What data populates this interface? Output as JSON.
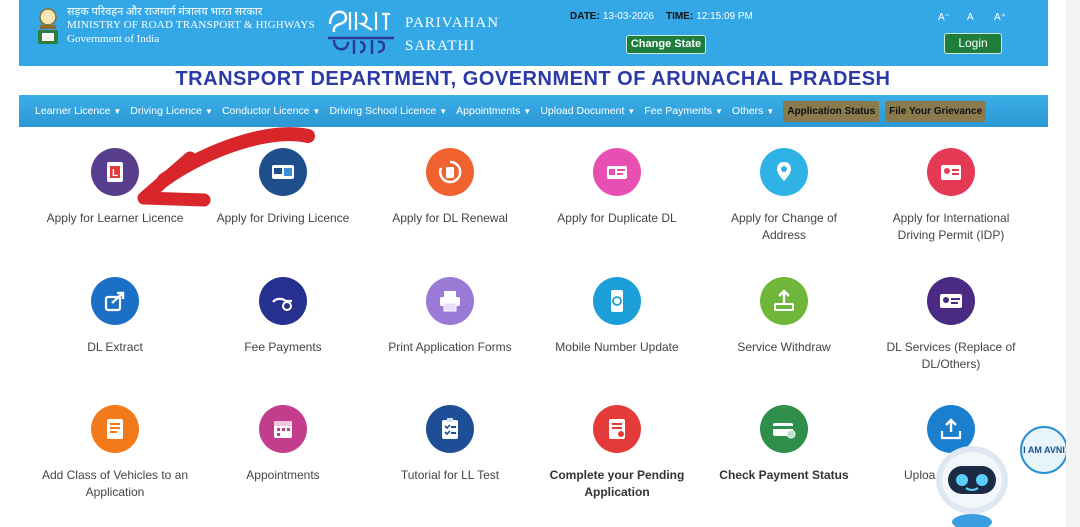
{
  "header": {
    "ministry_hindi": "सड़क परिवहन और राजमार्ग मंत्रालय भारत सरकार",
    "ministry_english": "MINISTRY OF ROAD TRANSPORT & HIGHWAYS",
    "government": "Government of India",
    "brand_line1": "PARIVAHAN",
    "brand_line2": "SARATHI",
    "date_label": "DATE:",
    "date_value": "13-03-2026",
    "time_label": "TIME:",
    "time_value": "12:15:09 PM",
    "change_state": "Change State",
    "login": "Login",
    "font_small": "A⁻",
    "font_normal": "A",
    "font_large": "A⁺"
  },
  "state_title": "TRANSPORT DEPARTMENT, GOVERNMENT OF ARUNACHAL PRADESH",
  "nav": {
    "items": [
      "Learner Licence",
      "Driving Licence",
      "Conductor Licence",
      "Driving School Licence",
      "Appointments",
      "Upload Document",
      "Fee Payments",
      "Others"
    ],
    "application_status": "Application Status",
    "grievance": "File Your Grievance"
  },
  "tiles": [
    {
      "label": "Apply for Learner Licence",
      "icon": "learner-licence-icon",
      "color": "#5a3e8e"
    },
    {
      "label": "Apply for Driving Licence",
      "icon": "driving-licence-icon",
      "color": "#1f4e8c"
    },
    {
      "label": "Apply for DL Renewal",
      "icon": "dl-renewal-icon",
      "color": "#f0622f"
    },
    {
      "label": "Apply for Duplicate DL",
      "icon": "duplicate-dl-icon",
      "color": "#e94fb3"
    },
    {
      "label": "Apply for Change of Address",
      "icon": "change-address-icon",
      "color": "#2fb2e6"
    },
    {
      "label": "Apply for International Driving Permit (IDP)",
      "icon": "idp-icon",
      "color": "#e43a55"
    },
    {
      "label": "DL Extract",
      "icon": "dl-extract-icon",
      "color": "#1b6fc4"
    },
    {
      "label": "Fee Payments",
      "icon": "fee-payments-icon",
      "color": "#25308f"
    },
    {
      "label": "Print Application Forms",
      "icon": "print-icon",
      "color": "#9a7ad6"
    },
    {
      "label": "Mobile Number Update",
      "icon": "mobile-update-icon",
      "color": "#1c9ed8"
    },
    {
      "label": "Service Withdraw",
      "icon": "service-withdraw-icon",
      "color": "#6fb63a"
    },
    {
      "label": "DL Services (Replace of DL/Others)",
      "icon": "dl-services-icon",
      "color": "#4a2a83"
    },
    {
      "label": "Add Class of Vehicles to an Application",
      "icon": "add-class-icon",
      "color": "#f27a1a"
    },
    {
      "label": "Appointments",
      "icon": "appointments-icon",
      "color": "#c43d8c"
    },
    {
      "label": "Tutorial for LL Test",
      "icon": "tutorial-icon",
      "color": "#1e4f96"
    },
    {
      "label": "Complete your Pending Application",
      "icon": "pending-application-icon",
      "color": "#e43a3a"
    },
    {
      "label": "Check Payment Status",
      "icon": "payment-status-icon",
      "color": "#2e8e4a"
    },
    {
      "label": "Uploa",
      "icon": "upload-icon",
      "color": "#1b7fd0"
    }
  ],
  "chatbot_bubble": "I AM AVNI",
  "colors": {
    "header": "#34a8e6",
    "title": "#2b3aa5",
    "button_green": "#1e7d3a",
    "annotation_arrow": "#d8262b"
  }
}
